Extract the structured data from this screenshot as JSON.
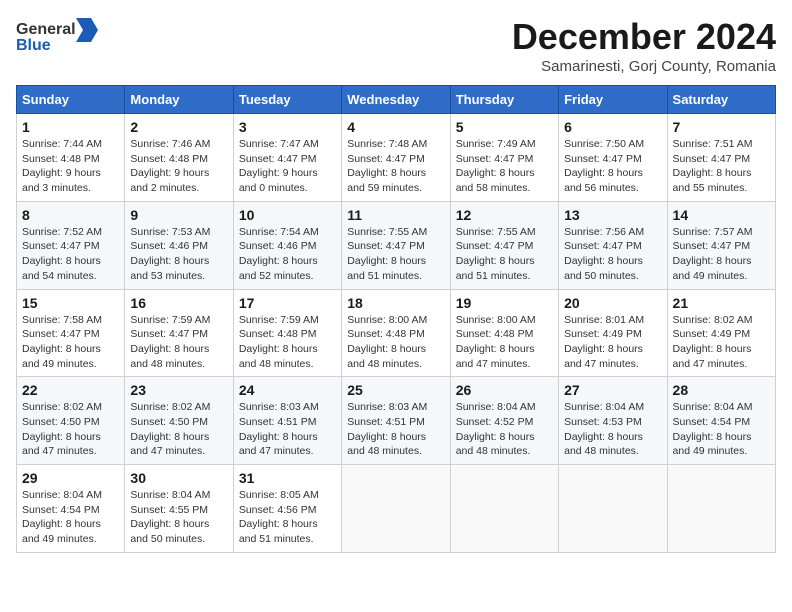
{
  "logo": {
    "general": "General",
    "blue": "Blue"
  },
  "title": "December 2024",
  "location": "Samarinesti, Gorj County, Romania",
  "days_of_week": [
    "Sunday",
    "Monday",
    "Tuesday",
    "Wednesday",
    "Thursday",
    "Friday",
    "Saturday"
  ],
  "weeks": [
    [
      {
        "day": "1",
        "sunrise": "7:44 AM",
        "sunset": "4:48 PM",
        "daylight": "9 hours and 3 minutes."
      },
      {
        "day": "2",
        "sunrise": "7:46 AM",
        "sunset": "4:48 PM",
        "daylight": "9 hours and 2 minutes."
      },
      {
        "day": "3",
        "sunrise": "7:47 AM",
        "sunset": "4:47 PM",
        "daylight": "9 hours and 0 minutes."
      },
      {
        "day": "4",
        "sunrise": "7:48 AM",
        "sunset": "4:47 PM",
        "daylight": "8 hours and 59 minutes."
      },
      {
        "day": "5",
        "sunrise": "7:49 AM",
        "sunset": "4:47 PM",
        "daylight": "8 hours and 58 minutes."
      },
      {
        "day": "6",
        "sunrise": "7:50 AM",
        "sunset": "4:47 PM",
        "daylight": "8 hours and 56 minutes."
      },
      {
        "day": "7",
        "sunrise": "7:51 AM",
        "sunset": "4:47 PM",
        "daylight": "8 hours and 55 minutes."
      }
    ],
    [
      {
        "day": "8",
        "sunrise": "7:52 AM",
        "sunset": "4:47 PM",
        "daylight": "8 hours and 54 minutes."
      },
      {
        "day": "9",
        "sunrise": "7:53 AM",
        "sunset": "4:46 PM",
        "daylight": "8 hours and 53 minutes."
      },
      {
        "day": "10",
        "sunrise": "7:54 AM",
        "sunset": "4:46 PM",
        "daylight": "8 hours and 52 minutes."
      },
      {
        "day": "11",
        "sunrise": "7:55 AM",
        "sunset": "4:47 PM",
        "daylight": "8 hours and 51 minutes."
      },
      {
        "day": "12",
        "sunrise": "7:55 AM",
        "sunset": "4:47 PM",
        "daylight": "8 hours and 51 minutes."
      },
      {
        "day": "13",
        "sunrise": "7:56 AM",
        "sunset": "4:47 PM",
        "daylight": "8 hours and 50 minutes."
      },
      {
        "day": "14",
        "sunrise": "7:57 AM",
        "sunset": "4:47 PM",
        "daylight": "8 hours and 49 minutes."
      }
    ],
    [
      {
        "day": "15",
        "sunrise": "7:58 AM",
        "sunset": "4:47 PM",
        "daylight": "8 hours and 49 minutes."
      },
      {
        "day": "16",
        "sunrise": "7:59 AM",
        "sunset": "4:47 PM",
        "daylight": "8 hours and 48 minutes."
      },
      {
        "day": "17",
        "sunrise": "7:59 AM",
        "sunset": "4:48 PM",
        "daylight": "8 hours and 48 minutes."
      },
      {
        "day": "18",
        "sunrise": "8:00 AM",
        "sunset": "4:48 PM",
        "daylight": "8 hours and 48 minutes."
      },
      {
        "day": "19",
        "sunrise": "8:00 AM",
        "sunset": "4:48 PM",
        "daylight": "8 hours and 47 minutes."
      },
      {
        "day": "20",
        "sunrise": "8:01 AM",
        "sunset": "4:49 PM",
        "daylight": "8 hours and 47 minutes."
      },
      {
        "day": "21",
        "sunrise": "8:02 AM",
        "sunset": "4:49 PM",
        "daylight": "8 hours and 47 minutes."
      }
    ],
    [
      {
        "day": "22",
        "sunrise": "8:02 AM",
        "sunset": "4:50 PM",
        "daylight": "8 hours and 47 minutes."
      },
      {
        "day": "23",
        "sunrise": "8:02 AM",
        "sunset": "4:50 PM",
        "daylight": "8 hours and 47 minutes."
      },
      {
        "day": "24",
        "sunrise": "8:03 AM",
        "sunset": "4:51 PM",
        "daylight": "8 hours and 47 minutes."
      },
      {
        "day": "25",
        "sunrise": "8:03 AM",
        "sunset": "4:51 PM",
        "daylight": "8 hours and 48 minutes."
      },
      {
        "day": "26",
        "sunrise": "8:04 AM",
        "sunset": "4:52 PM",
        "daylight": "8 hours and 48 minutes."
      },
      {
        "day": "27",
        "sunrise": "8:04 AM",
        "sunset": "4:53 PM",
        "daylight": "8 hours and 48 minutes."
      },
      {
        "day": "28",
        "sunrise": "8:04 AM",
        "sunset": "4:54 PM",
        "daylight": "8 hours and 49 minutes."
      }
    ],
    [
      {
        "day": "29",
        "sunrise": "8:04 AM",
        "sunset": "4:54 PM",
        "daylight": "8 hours and 49 minutes."
      },
      {
        "day": "30",
        "sunrise": "8:04 AM",
        "sunset": "4:55 PM",
        "daylight": "8 hours and 50 minutes."
      },
      {
        "day": "31",
        "sunrise": "8:05 AM",
        "sunset": "4:56 PM",
        "daylight": "8 hours and 51 minutes."
      },
      null,
      null,
      null,
      null
    ]
  ]
}
